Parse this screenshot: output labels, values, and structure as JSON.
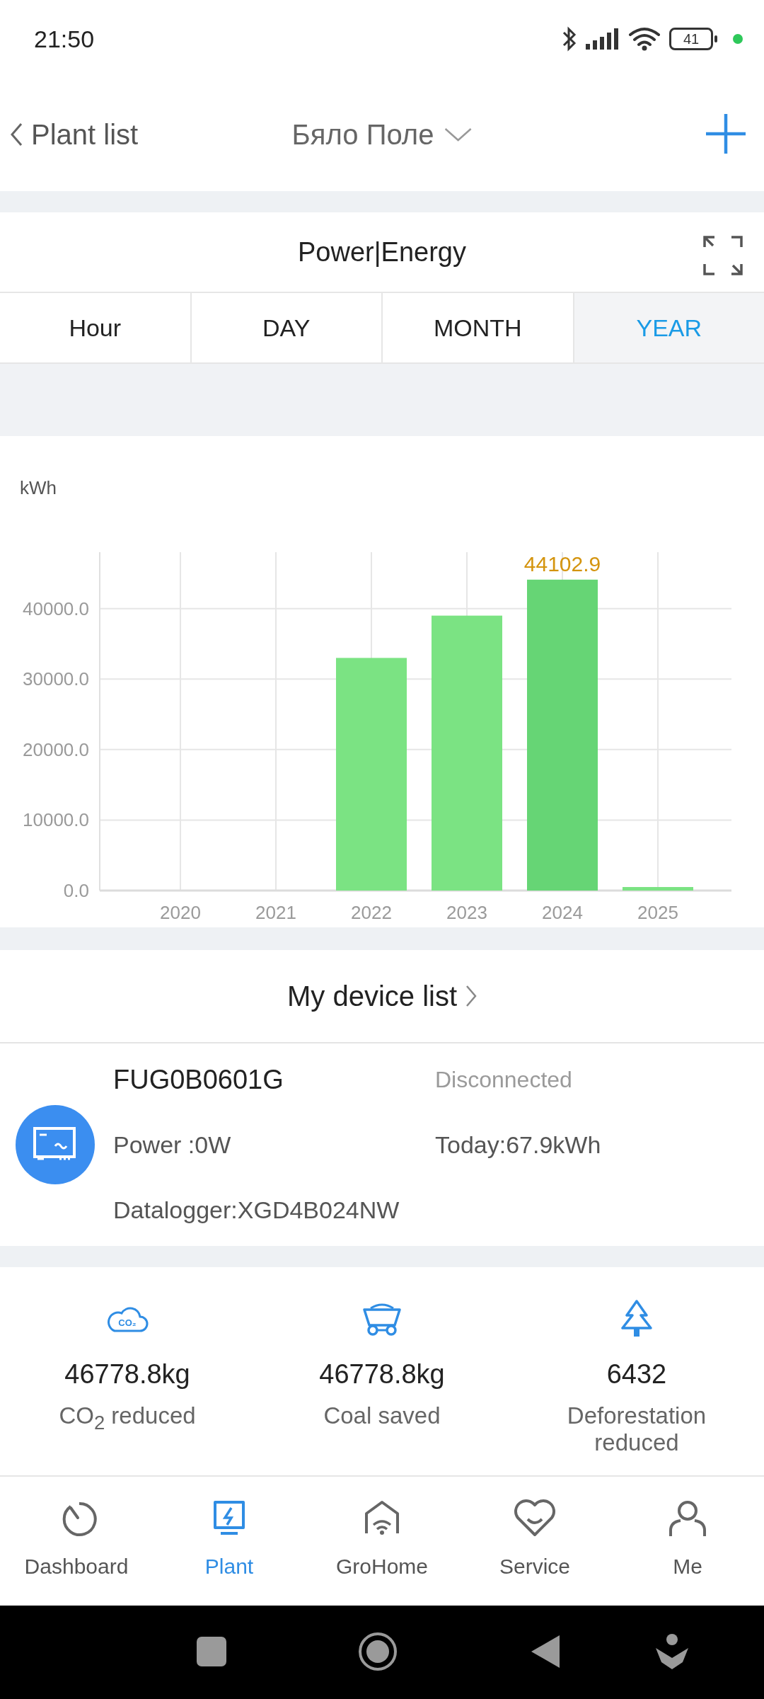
{
  "status_bar": {
    "time": "21:50",
    "battery": "41"
  },
  "header": {
    "back_label": "Plant list",
    "title": "Бяло Поле"
  },
  "energy_card": {
    "title": "Power|Energy",
    "tabs": [
      {
        "label": "Hour",
        "selected": false
      },
      {
        "label": "DAY",
        "selected": false
      },
      {
        "label": "MONTH",
        "selected": false
      },
      {
        "label": "YEAR",
        "selected": true
      }
    ],
    "chart_data": {
      "type": "bar",
      "ylabel": "kWh",
      "categories": [
        "2020",
        "2021",
        "2022",
        "2023",
        "2024",
        "2025"
      ],
      "series": [
        {
          "color": "#7be383",
          "values": [
            0,
            0,
            33000,
            39000,
            null,
            500
          ]
        },
        {
          "color": "#66d575",
          "values": [
            null,
            null,
            null,
            null,
            44102.9,
            null
          ]
        }
      ],
      "stacked": true,
      "grid": true,
      "ylim": [
        0,
        48000
      ],
      "yticks": [
        {
          "value": 0,
          "label": "0.0"
        },
        {
          "value": 10000,
          "label": "10000.0"
        },
        {
          "value": 20000,
          "label": "20000.0"
        },
        {
          "value": 30000,
          "label": "30000.0"
        },
        {
          "value": 40000,
          "label": "40000.0"
        }
      ],
      "annotations": [
        {
          "x": "2024",
          "y": 44102.9,
          "text": "44102.9"
        }
      ]
    }
  },
  "device_list": {
    "title": "My device list",
    "devices": [
      {
        "name": "FUG0B0601G",
        "status": "Disconnected",
        "power": "Power :0W",
        "today": "Today:67.9kWh",
        "datalogger": "Datalogger:XGD4B024NW"
      }
    ]
  },
  "stats": [
    {
      "kind": "co2",
      "icon_text": "CO₂",
      "value": "46778.8kg",
      "label": "CO$_{2}$ reduced"
    },
    {
      "kind": "coal",
      "value": "46778.8kg",
      "label": "Coal saved"
    },
    {
      "kind": "tree",
      "value": "6432",
      "label": "Deforestation reduced"
    }
  ],
  "bottom_nav": [
    {
      "kind": "dashboard",
      "label": "Dashboard",
      "selected": false
    },
    {
      "kind": "plant",
      "label": "Plant",
      "selected": true
    },
    {
      "kind": "home",
      "label": "GroHome",
      "selected": false
    },
    {
      "kind": "service",
      "label": "Service",
      "selected": false
    },
    {
      "kind": "me",
      "label": "Me",
      "selected": false
    }
  ]
}
